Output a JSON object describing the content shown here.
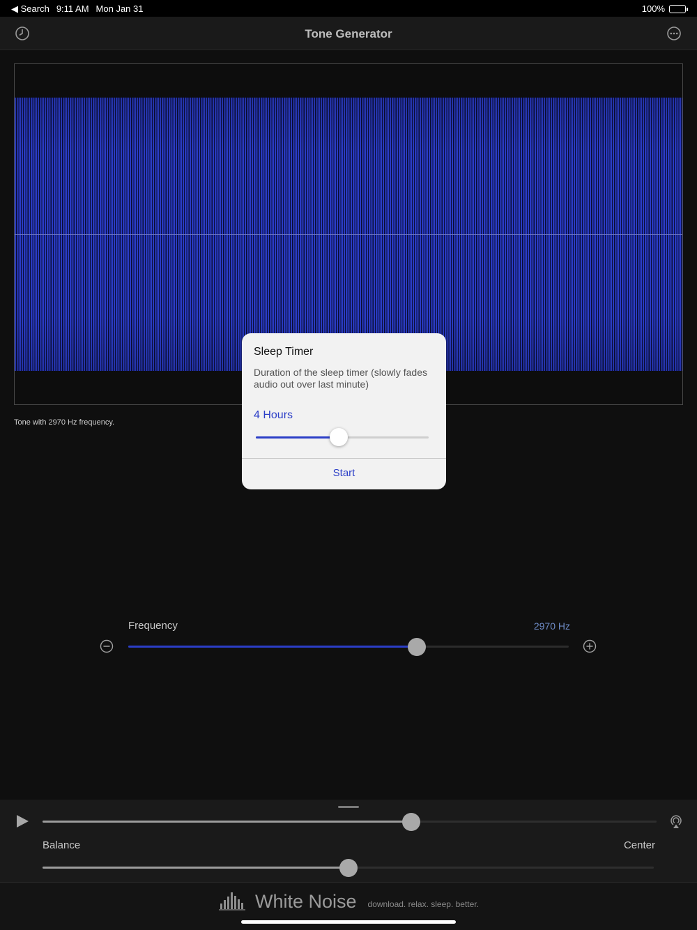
{
  "status_bar": {
    "back_label": "◀ Search",
    "time": "9:11 AM",
    "date": "Mon Jan 31",
    "battery": "100%"
  },
  "nav": {
    "title": "Tone Generator",
    "history_icon": "clock-icon",
    "more_icon": "ellipsis-circle-icon"
  },
  "waveform": {
    "caption": "Tone with 2970 Hz frequency.",
    "color": "#2a3bc4"
  },
  "sleep_timer": {
    "title": "Sleep Timer",
    "description": "Duration of the sleep timer (slowly fades audio out over last minute)",
    "value": "4 Hours",
    "level": 0.48,
    "start_label": "Start",
    "accent": "#2b3ec7"
  },
  "frequency": {
    "label": "Frequency",
    "value": "2970 Hz",
    "level": 0.655,
    "decrease_icon": "minus-circle-icon",
    "increase_icon": "plus-circle-icon",
    "accent": "#2b3ec7"
  },
  "player": {
    "play_icon": "play-icon",
    "volume_level": 0.6,
    "airplay_icon": "airplay-icon",
    "balance_label": "Balance",
    "balance_value": "Center",
    "balance_level": 0.5
  },
  "footer": {
    "brand_name": "White Noise",
    "tagline": "download. relax. sleep. better."
  }
}
